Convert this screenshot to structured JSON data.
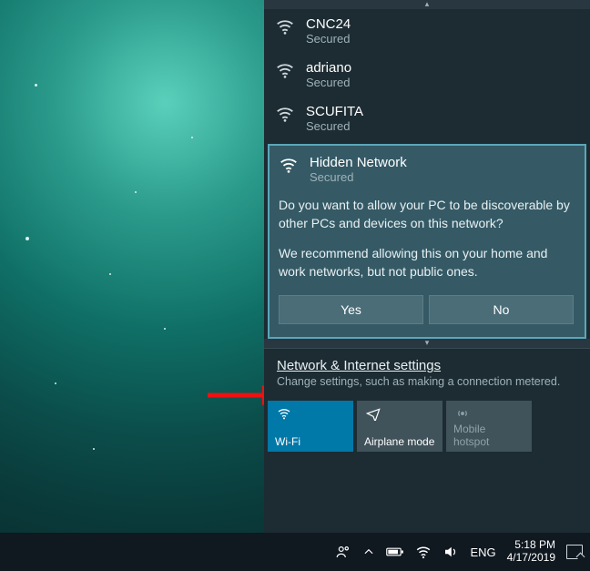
{
  "networks": [
    {
      "name": "CNC24",
      "status": "Secured"
    },
    {
      "name": "adriano",
      "status": "Secured"
    },
    {
      "name": "SCUFITA",
      "status": "Secured"
    }
  ],
  "selected": {
    "name": "Hidden Network",
    "status": "Secured",
    "prompt1": "Do you want to allow your PC to be discoverable by other PCs and devices on this network?",
    "prompt2": "We recommend allowing this on your home and work networks, but not public ones.",
    "yes": "Yes",
    "no": "No"
  },
  "settings": {
    "link": "Network & Internet settings",
    "sub": "Change settings, such as making a connection metered."
  },
  "tiles": {
    "wifi": "Wi-Fi",
    "airplane": "Airplane mode",
    "hotspot": "Mobile hotspot"
  },
  "taskbar": {
    "lang": "ENG",
    "time": "5:18 PM",
    "date": "4/17/2019"
  }
}
